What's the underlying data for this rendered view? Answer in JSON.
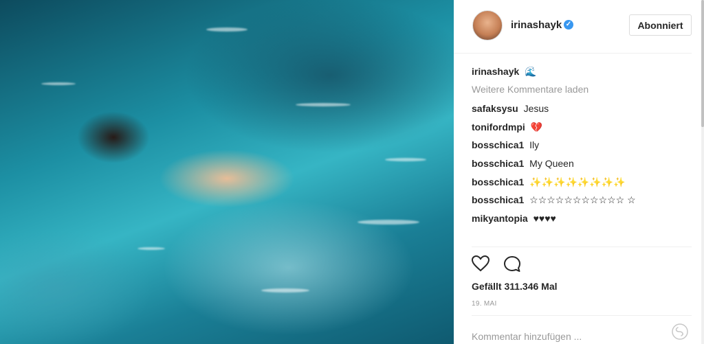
{
  "post": {
    "author": {
      "username": "irinashayk",
      "verified": true,
      "follow_label": "Abonniert"
    },
    "caption": {
      "username": "irinashayk",
      "text": "🌊"
    },
    "load_more_label": "Weitere Kommentare laden",
    "comments": [
      {
        "username": "safaksysu",
        "text": "Jesus"
      },
      {
        "username": "tonifordmpi",
        "text": "💔"
      },
      {
        "username": "bosschica1",
        "text": "Ily"
      },
      {
        "username": "bosschica1",
        "text": "My Queen"
      },
      {
        "username": "bosschica1",
        "text": "✨✨✨✨✨✨✨✨"
      },
      {
        "username": "bosschica1",
        "text": "☆☆☆☆☆☆☆☆☆☆☆ ☆"
      },
      {
        "username": "mikyantopia",
        "text": "♥♥♥♥"
      }
    ],
    "likes_text": "Gefällt 311.346 Mal",
    "date": "19. MAI",
    "comment_placeholder": "Kommentar hinzufügen ...",
    "icons": {
      "like": "heart-icon",
      "comment": "comment-bubble-icon",
      "more": "more-options-icon",
      "verified": "verified-badge-icon"
    },
    "colors": {
      "verified": "#3897f0",
      "muted": "#999999",
      "text": "#262626"
    }
  }
}
